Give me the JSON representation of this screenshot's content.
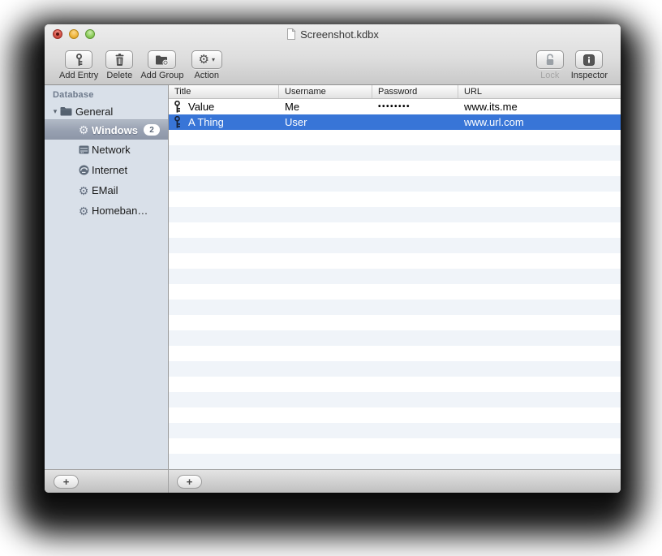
{
  "window": {
    "title": "Screenshot.kdbx"
  },
  "icons": {
    "gear": "⚙",
    "caret": "▾",
    "disclosure": "▾"
  },
  "toolbar": {
    "buttons": [
      {
        "label": "Add Entry",
        "icon": "key-icon"
      },
      {
        "label": "Delete",
        "icon": "trash-icon"
      },
      {
        "label": "Add Group",
        "icon": "folder-plus-icon"
      },
      {
        "label": "Action",
        "icon": "gear-icon"
      }
    ],
    "right_buttons": [
      {
        "label": "Lock",
        "icon": "open-padlock-icon",
        "disabled": true
      },
      {
        "label": "Inspector",
        "icon": "info-icon",
        "disabled": false
      }
    ]
  },
  "sidebar": {
    "section_label": "Database",
    "items": [
      {
        "label": "General",
        "icon": "folder-icon",
        "expanded": true
      },
      {
        "label": "Windows",
        "icon": "gear-icon",
        "badge": "2",
        "selected": true
      },
      {
        "label": "Network",
        "icon": "network-icon"
      },
      {
        "label": "Internet",
        "icon": "globe-icon"
      },
      {
        "label": "EMail",
        "icon": "gear-icon"
      },
      {
        "label": "Homeban…",
        "icon": "gear-icon"
      }
    ]
  },
  "table": {
    "columns": [
      "Title",
      "Username",
      "Password",
      "URL"
    ],
    "rows": [
      {
        "title": "Value",
        "username": "Me",
        "password": "••••••••",
        "url": "www.its.me",
        "selected": false
      },
      {
        "title": "A Thing",
        "username": "User",
        "password": "",
        "url": "www.url.com",
        "selected": true
      }
    ]
  },
  "bottombar": {
    "sidebar_add_label": "+",
    "entry_add_label": "+"
  },
  "colors": {
    "selection_blue": "#3875d7",
    "sidebar_bg": "#d9e0e9",
    "row_stripe": "#f0f4f9",
    "inactive_selection_top": "#b0b8c5",
    "inactive_selection_bottom": "#8d96a7"
  }
}
